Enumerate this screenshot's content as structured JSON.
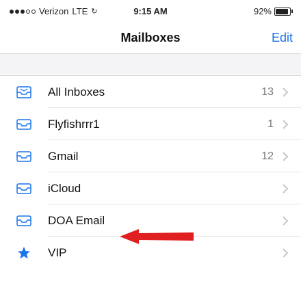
{
  "status_bar": {
    "carrier": "Verizon",
    "network": "LTE",
    "time": "9:15 AM",
    "battery": "92%",
    "battery_level": 0.92,
    "signal_bars_filled": 3,
    "signal_bars_total": 5
  },
  "nav": {
    "title": "Mailboxes",
    "edit_label": "Edit"
  },
  "mailboxes": [
    {
      "label": "All Inboxes",
      "count": "13",
      "icon": "inbox-tray-icon"
    },
    {
      "label": "Flyfishrrr1",
      "count": "1",
      "icon": "mailbox-tray-icon"
    },
    {
      "label": "Gmail",
      "count": "12",
      "icon": "mailbox-tray-icon"
    },
    {
      "label": "iCloud",
      "count": "",
      "icon": "mailbox-tray-icon"
    },
    {
      "label": "DOA Email",
      "count": "",
      "icon": "mailbox-tray-icon"
    },
    {
      "label": "VIP",
      "count": "",
      "icon": "star-icon"
    }
  ],
  "colors": {
    "accent": "#1a73e8",
    "annotation_arrow": "#e02020",
    "separator": "#e3e3e3"
  }
}
